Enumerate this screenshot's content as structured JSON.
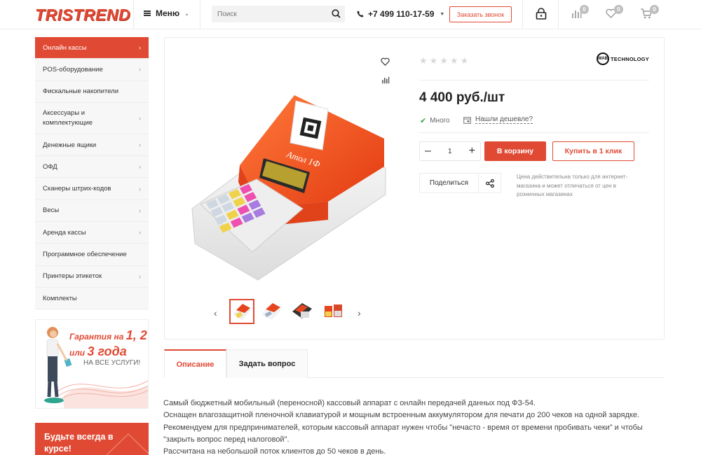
{
  "header": {
    "logo_text": "TRISTREND",
    "menu_label": "Меню",
    "search_placeholder": "Поиск",
    "phone": "+7 499 110-17-59",
    "callback_label": "Заказать звонок",
    "compare_count": "0",
    "favorites_count": "0",
    "cart_count": "0"
  },
  "sidebar": {
    "items": [
      {
        "label": "Онлайн кассы",
        "arrow": "›"
      },
      {
        "label": "POS-оборудование",
        "arrow": "›"
      },
      {
        "label": "Фискальные накопители",
        "arrow": ""
      },
      {
        "label": "Аксессуары и комплектующие",
        "arrow": "›"
      },
      {
        "label": "Денежные ящики",
        "arrow": "›"
      },
      {
        "label": "ОФД",
        "arrow": "›"
      },
      {
        "label": "Сканеры штрих-кодов",
        "arrow": "›"
      },
      {
        "label": "Весы",
        "arrow": "›"
      },
      {
        "label": "Аренда кассы",
        "arrow": "›"
      },
      {
        "label": "Программное обеспечение",
        "arrow": ""
      },
      {
        "label": "Принтеры этикеток",
        "arrow": "›"
      },
      {
        "label": "Комплекты",
        "arrow": ""
      }
    ],
    "promo": {
      "line1a": "Гарантия на ",
      "line1b": "1, 2",
      "line2a": "или ",
      "line2b": "3 года",
      "line3": "НА ВСЕ УСЛУГИ!"
    },
    "subscribe": {
      "line1": "Будьте всегда в",
      "line2": "курсе!"
    }
  },
  "product": {
    "brand": "WAB TECHNOLOGY",
    "brand_short": "WAB",
    "brand_rest": "TECHNOLOGY",
    "device_label": "Атол 1Ф",
    "price": "4 400 руб./шт",
    "stock": "Много",
    "cheaper_link": "Нашли дешевле?",
    "quantity": "1",
    "add_to_cart": "В корзину",
    "buy_one_click": "Купить в 1 клик",
    "share_label": "Поделиться",
    "price_note": "Цена действительна только для интернет-магазина и может отличаться от цен в розничных магазинах",
    "rating": 0
  },
  "tabs": [
    {
      "label": "Описание"
    },
    {
      "label": "Задать вопрос"
    }
  ],
  "description": {
    "lines": [
      "Самый бюджетный мобильный (переносной) кассовый аппарат с онлайн передачей данных под ФЗ-54.",
      "Оснащен влагозащитной пленочной клавиатурой и мощным встроенным аккумулятором для печати до 200 чеков на одной зарядке.",
      "Рекомендуем для предпринимателей, которым кассовый аппарат нужен чтобы \"нечасто - время от времени пробивать чеки\" и чтобы",
      "\"закрыть вопрос перед налоговой\".",
      "Рассчитана на небольшой поток клиентов до 50 чеков в день."
    ]
  },
  "colors": {
    "accent": "#e04a34",
    "in_stock": "#39a84a",
    "badge": "#bfbfbf"
  }
}
